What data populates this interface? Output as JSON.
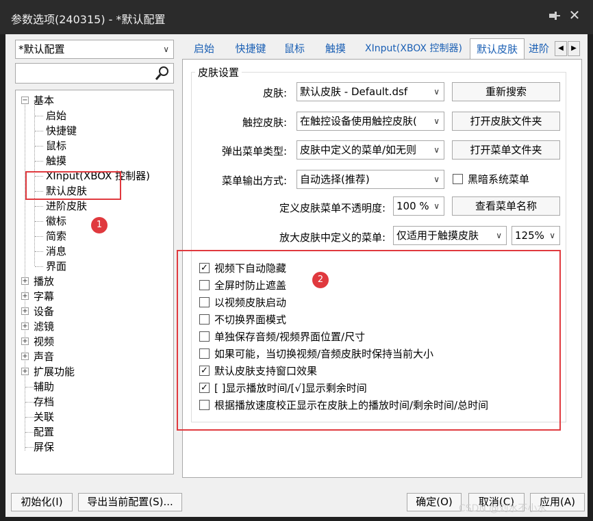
{
  "window": {
    "title": "参数选项(240315) - *默认配置"
  },
  "profile_select": {
    "value": "*默认配置"
  },
  "tree": {
    "items": [
      {
        "label": "基本",
        "type": "expanded"
      },
      {
        "label": "启始",
        "type": "child"
      },
      {
        "label": "快捷键",
        "type": "child"
      },
      {
        "label": "鼠标",
        "type": "child"
      },
      {
        "label": "触摸",
        "type": "child"
      },
      {
        "label": "XInput(XBOX 控制器)",
        "type": "child"
      },
      {
        "label": "默认皮肤",
        "type": "child"
      },
      {
        "label": "进阶皮肤",
        "type": "child"
      },
      {
        "label": "徽标",
        "type": "child"
      },
      {
        "label": "简索",
        "type": "child"
      },
      {
        "label": "消息",
        "type": "child"
      },
      {
        "label": "界面",
        "type": "child"
      },
      {
        "label": "播放",
        "type": "collapsed"
      },
      {
        "label": "字幕",
        "type": "collapsed"
      },
      {
        "label": "设备",
        "type": "collapsed"
      },
      {
        "label": "滤镜",
        "type": "collapsed"
      },
      {
        "label": "视频",
        "type": "collapsed"
      },
      {
        "label": "声音",
        "type": "collapsed"
      },
      {
        "label": "扩展功能",
        "type": "collapsed"
      },
      {
        "label": "辅助",
        "type": "leaf"
      },
      {
        "label": "存档",
        "type": "leaf"
      },
      {
        "label": "关联",
        "type": "leaf"
      },
      {
        "label": "配置",
        "type": "leaf"
      },
      {
        "label": "屏保",
        "type": "leaf"
      }
    ]
  },
  "tabs": [
    "启始",
    "快捷键",
    "鼠标",
    "触摸",
    "XInput(XBOX 控制器)",
    "默认皮肤",
    "进阶"
  ],
  "active_tab": "默认皮肤",
  "skin_settings": {
    "group_title": "皮肤设置",
    "skin_label": "皮肤:",
    "skin_value": "默认皮肤 - Default.dsf",
    "rescan_button": "重新搜索",
    "touch_skin_label": "触控皮肤:",
    "touch_skin_value": "在触控设备使用触控皮肤(",
    "open_skin_folder_button": "打开皮肤文件夹",
    "popup_menu_type_label": "弹出菜单类型:",
    "popup_menu_type_value": "皮肤中定义的菜单/如无则",
    "open_menu_folder_button": "打开菜单文件夹",
    "menu_output_label": "菜单输出方式:",
    "menu_output_value": "自动选择(推荐)",
    "dark_menu_checkbox": {
      "label": "黑暗系统菜单",
      "checked": false
    },
    "menu_opacity_label": "定义皮肤菜单不透明度:",
    "menu_opacity_value": "100 %",
    "view_menu_names_button": "查看菜单名称",
    "enlarge_menu_label": "放大皮肤中定义的菜单:",
    "enlarge_menu_value": "仅适用于触摸皮肤",
    "enlarge_percent_value": "125%"
  },
  "options": [
    {
      "label": "视频下自动隐藏",
      "checked": true
    },
    {
      "label": "全屏时防止遮盖",
      "checked": false
    },
    {
      "label": "以视频皮肤启动",
      "checked": false
    },
    {
      "label": "不切换界面模式",
      "checked": false
    },
    {
      "label": "单独保存音频/视频界面位置/尺寸",
      "checked": false
    },
    {
      "label": "如果可能，当切换视频/音频皮肤时保持当前大小",
      "checked": false
    },
    {
      "label": "默认皮肤支持窗口效果",
      "checked": true
    },
    {
      "label": "[ ]显示播放时间/[√]显示剩余时间",
      "checked": true
    },
    {
      "label": "根据播放速度校正显示在皮肤上的播放时间/剩余时间/总时间",
      "checked": false
    }
  ],
  "annotations": {
    "badge1": "1",
    "badge2": "2",
    "color": "#e0393e"
  },
  "footer": {
    "init_button": "初始化(I)",
    "export_button": "导出当前配置(S)...",
    "ok_button": "确定(O)",
    "cancel_button": "取消(C)",
    "apply_button": "应用(A)"
  },
  "watermark": "CSDN @刘水不小水"
}
